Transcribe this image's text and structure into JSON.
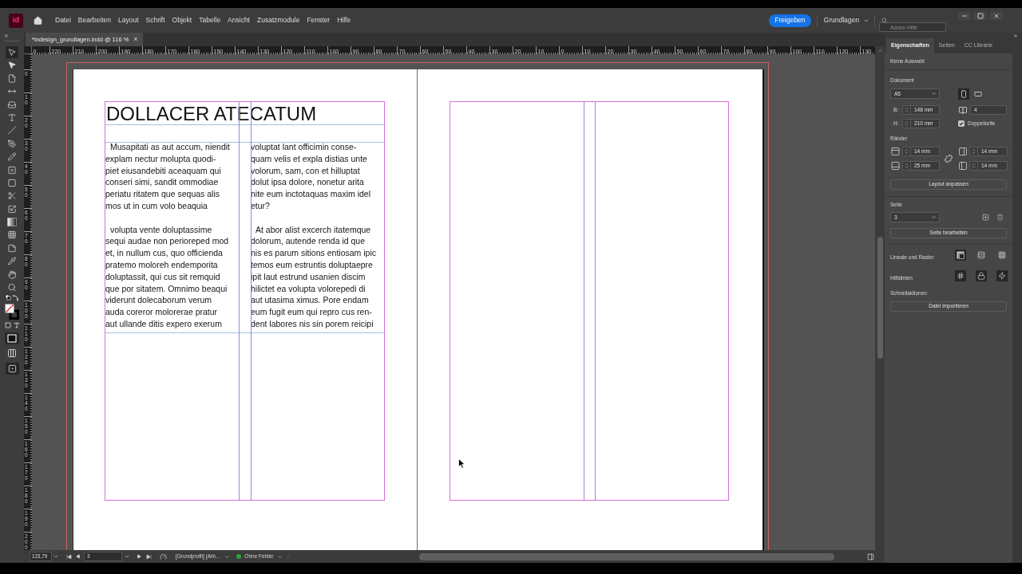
{
  "app": {
    "logo": "Id",
    "menu": [
      "Datei",
      "Bearbeiten",
      "Layout",
      "Schrift",
      "Objekt",
      "Tabelle",
      "Ansicht",
      "Zusatzmodule",
      "Fenster",
      "Hilfe"
    ],
    "share_button": "Freigeben",
    "workspace": "Grundlagen",
    "search": {
      "placeholder": "Adobe-Hilfe"
    }
  },
  "document_tab": {
    "title": "*indesign_grundlagen.indd @ 116 %",
    "close": "×"
  },
  "tools": [
    {
      "kind": "selection",
      "selected": true
    },
    {
      "kind": "direct",
      "selected": false
    },
    {
      "kind": "page",
      "selected": false
    },
    {
      "kind": "gap",
      "selected": false
    },
    {
      "kind": "collector",
      "selected": false
    },
    {
      "kind": "type",
      "selected": false
    },
    {
      "kind": "line",
      "selected": false
    },
    {
      "kind": "pen",
      "selected": false
    },
    {
      "kind": "pencil",
      "selected": false
    },
    {
      "kind": "frame",
      "selected": false
    },
    {
      "kind": "rectangle",
      "selected": false
    },
    {
      "kind": "scissors",
      "selected": false
    },
    {
      "kind": "transform",
      "selected": false
    },
    {
      "kind": "gradient",
      "selected": false
    },
    {
      "kind": "feather",
      "selected": false
    },
    {
      "kind": "note",
      "selected": false
    },
    {
      "kind": "eyedropper",
      "selected": false
    },
    {
      "kind": "hand",
      "selected": false
    },
    {
      "kind": "zoom",
      "selected": false
    }
  ],
  "toolbar_bottom": [
    {
      "kind": "defaults",
      "on": false
    },
    {
      "kind": "swatches",
      "on": false
    },
    {
      "kind": "formatting",
      "on": false
    },
    {
      "kind": "apply",
      "on": true
    },
    {
      "kind": "view",
      "on": false
    },
    {
      "kind": "screen",
      "on": true
    }
  ],
  "rulers": {
    "horizontal": [
      "0",
      "220",
      "210",
      "200",
      "190",
      "180",
      "170",
      "160",
      "150",
      "140",
      "130",
      "120",
      "110",
      "100",
      "90",
      "80",
      "70",
      "60",
      "50",
      "40",
      "30",
      "20",
      "10",
      "0",
      "10",
      "20",
      "30",
      "40",
      "50",
      "60",
      "70",
      "80",
      "90",
      "100",
      "110",
      "120",
      "130"
    ],
    "vertical": [
      "0",
      "10",
      "20",
      "30",
      "40",
      "50",
      "60",
      "70",
      "80",
      "90",
      "100",
      "110",
      "120",
      "130",
      "140",
      "150",
      "160",
      "170",
      "180",
      "190",
      "200"
    ]
  },
  "spread": {
    "left_page": {
      "heading": "DOLLACER ATECATUM",
      "columns": [
        {
          "paragraphs": [
            {
              "indent": true,
              "lines": [
                "Musapitati as aut accum, niendit",
                "explam nectur molupta quodi-",
                "piet eiusandebiti aceaquam qui",
                "conseri simi, sandit ommodiae",
                "periatu ritatem que sequas alis",
                "mos ut in cum volo beaquia"
              ]
            },
            {
              "indent": true,
              "lines": [
                "volupta vente doluptassime",
                "sequi audae non perioreped mod",
                "et, in nullum cus, quo officienda",
                "pratemo moloreh endemporita",
                "doluptassit, qui cus sit remquid",
                "que por sitatem. Omnimo beaqui",
                "viderunt dolecaborum verum",
                "auda coreror molorerae pratur",
                "aut ullande ditis expero exerum"
              ]
            }
          ]
        },
        {
          "paragraphs": [
            {
              "indent": false,
              "lines": [
                "voluptat lant officimin conse-",
                "quam velis et expla distias unte",
                "volorum, sam, con et hilluptat",
                "dolut ipsa dolore, nonetur arita",
                "nite eum inctotaquas maxim idel",
                "etur?"
              ]
            },
            {
              "indent": true,
              "lines": [
                "At abor alist excerch itatemque",
                "dolorum, autende renda id que",
                "nis es parum sitions entiosam ipic",
                "temos eum estruntis doluptaepre",
                "ipit laut estrund usanien discim",
                "hilictet ea volupta volorepedi di",
                "aut utasima ximus. Pore endam",
                "eum fugit eum qui repro cus ren-",
                "dent labores nis sin porem reicipi"
              ]
            }
          ]
        }
      ]
    }
  },
  "status_bar": {
    "zoom": "115,79",
    "page": "3",
    "profile": "[Grundprofil] (Arb…",
    "preflight": {
      "label": "Ohne Fehler",
      "color": "#2aa832"
    }
  },
  "properties": {
    "tabs": [
      {
        "label": "Eigenschaften",
        "selected": true
      },
      {
        "label": "Seiten",
        "selected": false
      },
      {
        "label": "CC Librarie",
        "selected": false
      }
    ],
    "selection_info": "Keine Auswahl",
    "document": {
      "heading": "Dokument",
      "size": "A5",
      "orientation": [
        {
          "kind": "portrait",
          "selected": true
        },
        {
          "kind": "landscape",
          "selected": false
        }
      ],
      "width": {
        "label": "B:",
        "value": "148 mm"
      },
      "height": {
        "label": "H:",
        "value": "210 mm"
      },
      "pages": "4",
      "facing_pages": {
        "label": "Doppelseite",
        "checked": true
      }
    },
    "margins": {
      "heading": "Ränder",
      "fields": [
        {
          "kind": "top",
          "value": "14 mm"
        },
        {
          "kind": "inside",
          "value": "14 mm"
        },
        {
          "kind": "bottom",
          "value": "25 mm"
        },
        {
          "kind": "outside",
          "value": "14 mm"
        }
      ],
      "linked": false,
      "button": "Layout anpassen"
    },
    "page": {
      "heading": "Seite",
      "value": "3",
      "button": "Seite bearbeiten"
    },
    "rulers_grids": {
      "label": "Lineale und Raster",
      "toggles": [
        {
          "kind": "rulers",
          "on": true
        },
        {
          "kind": "baseline",
          "on": false
        },
        {
          "kind": "grid",
          "on": false
        }
      ]
    },
    "guides": {
      "label": "Hilfslinien",
      "toggles": [
        {
          "kind": "guides",
          "on": true
        },
        {
          "kind": "lock",
          "on": true
        },
        {
          "kind": "smart",
          "on": true
        }
      ]
    },
    "quick_actions": {
      "heading": "Schnellaktionen",
      "button": "Datei importieren"
    }
  }
}
